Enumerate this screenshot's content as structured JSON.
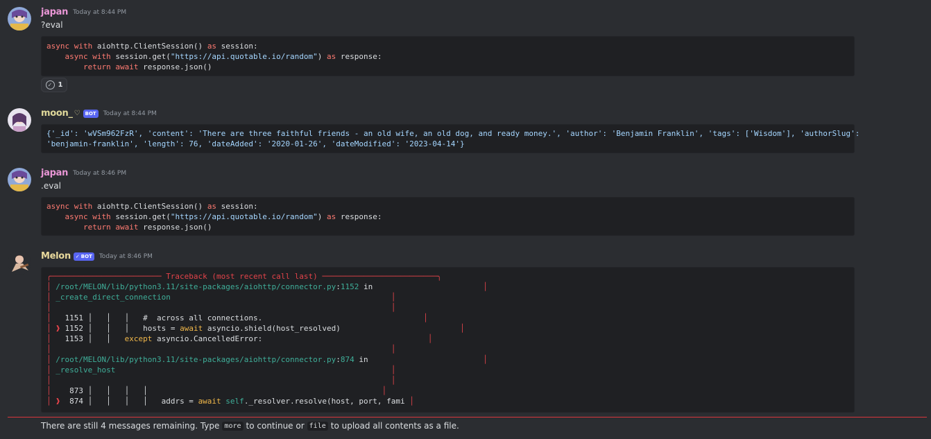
{
  "messages": {
    "m1": {
      "author": "japan",
      "timestamp": "Today at 8:44 PM",
      "text": "?eval"
    },
    "m2": {
      "author": "moon_",
      "timestamp": "Today at 8:44 PM",
      "bot_label": "BOT"
    },
    "m3": {
      "author": "japan",
      "timestamp": "Today at 8:46 PM",
      "text": ".eval"
    },
    "m4": {
      "author": "Melon",
      "timestamp": "Today at 8:46 PM",
      "bot_label": "BOT"
    }
  },
  "code1": {
    "l1_kw": "async with",
    "l1_rest": " aiohttp.ClientSession() ",
    "l1_as": "as",
    "l1_end": " session:",
    "l2_kw": "async with",
    "l2_rest": " session.get(",
    "l2_str": "\"https://api.quotable.io/random\"",
    "l2_close": ") ",
    "l2_as": "as",
    "l2_end": " response:",
    "l3_ret": "return",
    "l3_aw": "await",
    "l3_end": " response.json()"
  },
  "code3": {
    "l1_kw": "async with",
    "l1_rest": " aiohttp.ClientSession() ",
    "l1_as": "as",
    "l1_end": " session:",
    "l2_kw": "async with",
    "l2_rest": " session.get(",
    "l2_str": "\"https://api.quotable.io/random\"",
    "l2_close": ") ",
    "l2_as": "as",
    "l2_end": " response:",
    "l3_ret": "return",
    "l3_aw": "await",
    "l3_end": " response.json()"
  },
  "reaction": {
    "count": "1"
  },
  "result": {
    "line1": "{'_id': 'wVSm962FzR', 'content': 'There are three faithful friends - an old wife, an old dog, and ready money.', 'author': 'Benjamin Franklin', 'tags': ['Wisdom'], 'authorSlug':",
    "line2": "'benjamin-franklin', 'length': 76, 'dateAdded': '2020-01-26', 'dateModified': '2023-04-14'}"
  },
  "traceback": {
    "title": "Traceback (most recent call last)",
    "path1": "/root/MELON/lib/python3.11/site-packages/aiohttp/connector.py",
    "line1": "1152",
    "in": "in",
    "func1": "_create_direct_connection",
    "r1151": "   1151 │   │   │   #  across all connections.",
    "r1152a": "1152 │   │   │   hosts = ",
    "r1152aw": "await",
    "r1152b": " asyncio.shield(host_resolved)",
    "r1153a": "   1153 │   │   ",
    "r1153ex": "except",
    "r1153b": " asyncio.CancelledError:",
    "path2": "/root/MELON/lib/python3.11/site-packages/aiohttp/connector.py",
    "line2": "874",
    "func2": "_resolve_host",
    "r873": "    873 │   │   │   │",
    "r874a": " 874 │   │   │   │   addrs = ",
    "r874aw": "await",
    "r874self": " self",
    "r874b": "._resolver.resolve(host, port, fami"
  },
  "footer": {
    "pre": "There are still 4 messages remaining. Type",
    "more": "more",
    "mid": "to continue or",
    "file": "file",
    "post": "to upload all contents as a file."
  },
  "colors": {
    "background": "#2b2d31",
    "codeblock": "#1f2023",
    "error": "#e3434a",
    "bot_badge": "#5865f2"
  }
}
